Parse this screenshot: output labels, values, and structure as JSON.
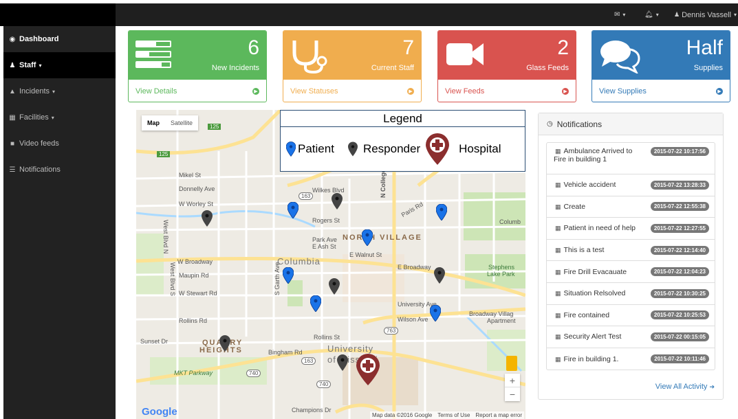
{
  "header": {
    "mail_icon": "envelope-icon",
    "bell_icon": "bell-icon",
    "user_name": "Dennis Vassell",
    "user_icon": "user-icon",
    "caret": "▾"
  },
  "sidebar": {
    "items": [
      {
        "icon": "dashboard-icon",
        "glyph": "◉",
        "label": "Dashboard",
        "caret": ""
      },
      {
        "icon": "staff-icon",
        "glyph": "♟",
        "label": "Staff",
        "caret": "▾"
      },
      {
        "icon": "warning-icon",
        "glyph": "▲",
        "label": "Incidents",
        "caret": "▾"
      },
      {
        "icon": "building-icon",
        "glyph": "▦",
        "label": "Facilities",
        "caret": "▾"
      },
      {
        "icon": "video-camera-icon",
        "glyph": "■",
        "label": "Video feeds",
        "caret": ""
      },
      {
        "icon": "list-icon",
        "glyph": "☰",
        "label": "Notifications",
        "caret": ""
      }
    ]
  },
  "panels": [
    {
      "number": "6",
      "label": "New Incidents",
      "link": "View Details",
      "icon": "tasks-icon",
      "color": "#5cb85c"
    },
    {
      "number": "7",
      "label": "Current Staff",
      "link": "View Statuses",
      "icon": "stethoscope-icon",
      "color": "#f0ad4e"
    },
    {
      "number": "2",
      "label": "Glass Feeds",
      "link": "View Feeds",
      "icon": "video-camera-icon",
      "color": "#d9534f"
    },
    {
      "number": "Half",
      "label": "Supplies",
      "link": "View Supplies",
      "icon": "comments-icon",
      "color": "#337ab7"
    }
  ],
  "map": {
    "type_map": "Map",
    "type_satellite": "Satellite",
    "labels": {
      "columbia": "Columbia",
      "north_village": "NORTH VILLAGE",
      "quarry_heights_1": "QUARRY",
      "quarry_heights_2": "HEIGHTS",
      "university": "University",
      "of_missouri": "of Missouri",
      "stephens_lake": "Stephens",
      "stephens_lake_2": "Lake Park",
      "broadway_village": "Broadway Villag",
      "broadway_village_2": "Apartment",
      "columbia_college": "Columb",
      "mkt_parkway": "MKT Parkway",
      "w_broadway": "W Broadway",
      "e_broadway": "E Broadway",
      "w_worley": "W Worley St",
      "rogers": "Rogers St",
      "park_ave": "Park Ave",
      "e_ash": "E Ash St",
      "e_walnut": "E Walnut St",
      "maupin": "Maupin Rd",
      "stewart": "W Stewart Rd",
      "rollins_rd": "Rollins Rd",
      "rollins_st": "Rollins St",
      "sunset": "Sunset Dr",
      "bingham": "Bingham Rd",
      "champions": "Champions Dr",
      "wilkes": "Wilkes Blvd",
      "donnelly": "Donnelly Ave",
      "mikel": "Mikel St",
      "college_ave": "N College Ave",
      "paris_rd": "Paris Rd",
      "university_ave": "University Ave",
      "wilson_ave": "Wilson Ave",
      "west_blvd": "West Blvd N",
      "west_blvd_s": "West Blvd S",
      "garth": "S Garth Ave",
      "hwy_125a": "125",
      "hwy_125b": "125",
      "hwy_163a": "163",
      "hwy_163b": "163",
      "hwy_763": "763",
      "hwy_740a": "740",
      "hwy_740b": "740"
    },
    "zoom_in": "+",
    "zoom_out": "−",
    "google": "Google",
    "attribution": [
      "Map data ©2016 Google",
      "Terms of Use",
      "Report a map error"
    ],
    "pins": [
      {
        "kind": "patient",
        "color": "#1a73e8"
      },
      {
        "kind": "patient",
        "color": "#1a73e8"
      },
      {
        "kind": "patient",
        "color": "#1a73e8"
      },
      {
        "kind": "patient",
        "color": "#1a73e8"
      },
      {
        "kind": "patient",
        "color": "#1a73e8"
      },
      {
        "kind": "patient",
        "color": "#1a73e8"
      },
      {
        "kind": "patient",
        "color": "#1a73e8"
      },
      {
        "kind": "responder",
        "color": "#444444"
      },
      {
        "kind": "responder",
        "color": "#444444"
      },
      {
        "kind": "responder",
        "color": "#444444"
      },
      {
        "kind": "responder",
        "color": "#444444"
      },
      {
        "kind": "responder",
        "color": "#444444"
      },
      {
        "kind": "responder",
        "color": "#444444"
      },
      {
        "kind": "hospital",
        "color": "#8b2e2e"
      }
    ]
  },
  "legend": {
    "title": "Legend",
    "patient": "Patient",
    "responder": "Responder",
    "hospital": "Hospital"
  },
  "notifications": {
    "title": "Notifications",
    "items": [
      {
        "text": "Ambulance Arrived to Fire in building 1",
        "text_line1": "Ambulance Arrived to",
        "text_line2": "Fire in building 1",
        "time": "2015-07-22 10:17:56"
      },
      {
        "text": "Vehicle accident",
        "time": "2015-07-22 13:28:33"
      },
      {
        "text": "Create",
        "time": "2015-07-22 12:55:38"
      },
      {
        "text": "Patient in need of help",
        "time": "2015-07-22 12:27:55"
      },
      {
        "text": "This is a test",
        "time": "2015-07-22 12:14:40"
      },
      {
        "text": "Fire Drill Evacauate",
        "time": "2015-07-22 12:04:23"
      },
      {
        "text": "Situation Relsolved",
        "time": "2015-07-22 10:30:25"
      },
      {
        "text": "Fire contained",
        "time": "2015-07-22 10:25:53"
      },
      {
        "text": "Security Alert Test",
        "time": "2015-07-22 00:15:05"
      },
      {
        "text": "Fire in building 1.",
        "time": "2015-07-22 10:11:46"
      }
    ],
    "view_all": "View All Activity"
  }
}
